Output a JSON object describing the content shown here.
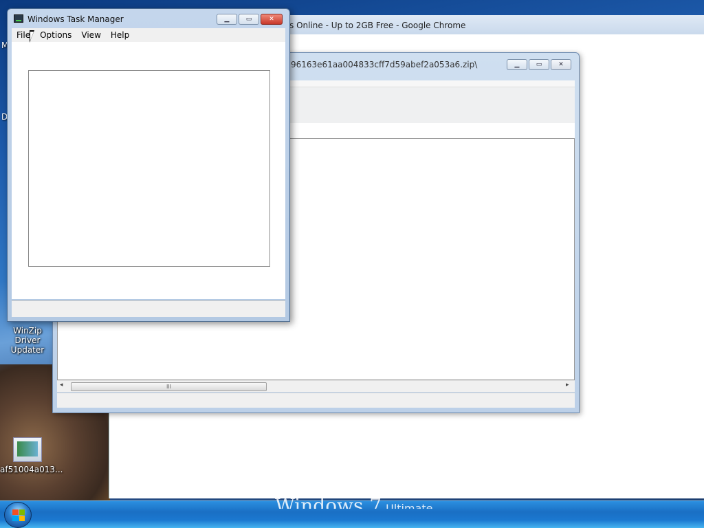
{
  "chrome": {
    "title": "s Online - Up to 2GB Free - Google Chrome"
  },
  "zip_window": {
    "title": "96163e61aa004833cff7d59abef2a053a6.zip\\",
    "minimize_icon": "minimize-icon",
    "maximize_icon": "maximize-icon",
    "close_icon": "close-icon",
    "scroll_thumb_grip": "III",
    "scroll_left": "◂",
    "scroll_right": "▸"
  },
  "task_manager": {
    "title": "Windows Task Manager",
    "menu": [
      {
        "label": "File"
      },
      {
        "label": "Options"
      },
      {
        "label": "View"
      },
      {
        "label": "Help"
      }
    ],
    "icon": "task-manager-icon"
  },
  "desktop": {
    "icons": [
      {
        "label": "WinZip Driver Updater"
      },
      {
        "label": "af51004a013..."
      }
    ],
    "edge_letters": [
      "M",
      "D"
    ]
  },
  "taskbar": {
    "watermark": "Windows 7",
    "watermark_edition": "Ultimate",
    "start_icon": "windows-start-icon"
  },
  "colors": {
    "taskbar": "#1a6fc4",
    "window_frame": "#b3c9e3",
    "close_button": "#d9483a"
  }
}
